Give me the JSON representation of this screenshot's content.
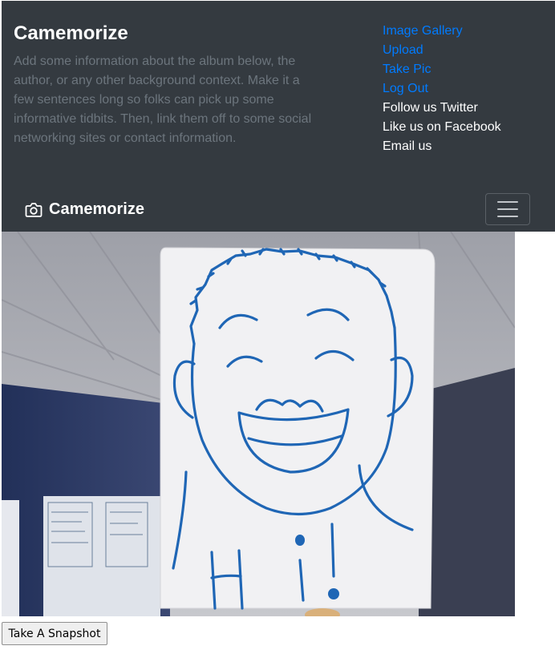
{
  "header": {
    "about_title": "Camemorize",
    "about_text": "Add some information about the album below, the author, or any other background context. Make it a few sentences long so folks can pick up some informative tidbits. Then, link them off to some social networking sites or contact information.",
    "links": [
      {
        "label": "Image Gallery",
        "color": "#007bff"
      },
      {
        "label": "Upload",
        "color": "#007bff"
      },
      {
        "label": "Take Pic",
        "color": "#007bff"
      },
      {
        "label": "Log Out",
        "color": "#007bff"
      },
      {
        "label": "Follow us Twitter",
        "color": "#ffffff"
      },
      {
        "label": "Like us on Facebook",
        "color": "#ffffff"
      },
      {
        "label": "Email us",
        "color": "#ffffff"
      }
    ]
  },
  "navbar": {
    "brand": "Camemorize",
    "brand_icon": "camera-icon",
    "toggler_icon": "hamburger-icon"
  },
  "video": {
    "description": "webcam feed"
  },
  "actions": {
    "snapshot_label": "Take A Snapshot"
  },
  "colors": {
    "header_bg": "#343a40",
    "link": "#007bff",
    "muted": "#6c757d"
  }
}
